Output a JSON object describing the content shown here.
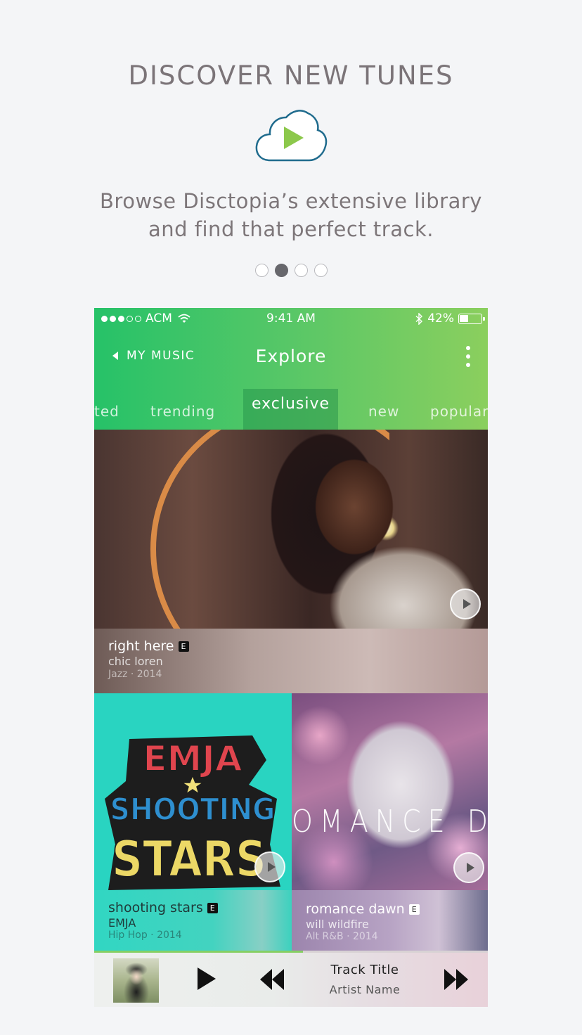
{
  "onboarding": {
    "headline": "DISCOVER NEW TUNES",
    "icon": "cloud-play-icon",
    "tagline_line1": "Browse Disctopia’s extensive library",
    "tagline_line2": "and find that perfect track.",
    "page_indicator": {
      "total": 4,
      "active": 2
    }
  },
  "status_bar": {
    "carrier": "ACM",
    "time": "9:41 AM",
    "battery": "42%",
    "battery_level": 0.42
  },
  "nav": {
    "back_label": "MY MUSIC",
    "title": "Explore"
  },
  "tabs": [
    {
      "label": "ted",
      "active": false
    },
    {
      "label": "trending",
      "active": false
    },
    {
      "label": "exclusive",
      "active": true
    },
    {
      "label": "new",
      "active": false
    },
    {
      "label": "popular",
      "active": false
    }
  ],
  "featured": {
    "title": "right here",
    "explicit": "E",
    "artist": "chic loren",
    "meta": "Jazz · 2014"
  },
  "grid": [
    {
      "title": "shooting stars",
      "explicit": "E",
      "artist": "EMJA",
      "meta": "Hip Hop · 2014",
      "art_text": [
        "EMJA",
        "SHOOTING",
        "STARS"
      ]
    },
    {
      "title": "romance dawn",
      "explicit": "E",
      "artist": "will wildfire",
      "meta": "Alt R&B · 2014",
      "art_text": "OMANCE DAW"
    }
  ],
  "player": {
    "track_title": "Track Title",
    "artist_name": "Artist Name",
    "progress": 0.53
  },
  "colors": {
    "green_start": "#26c268",
    "green_end": "#8bcf5e",
    "accent_ring": "#d98b47",
    "teal": "#29d4c1"
  }
}
